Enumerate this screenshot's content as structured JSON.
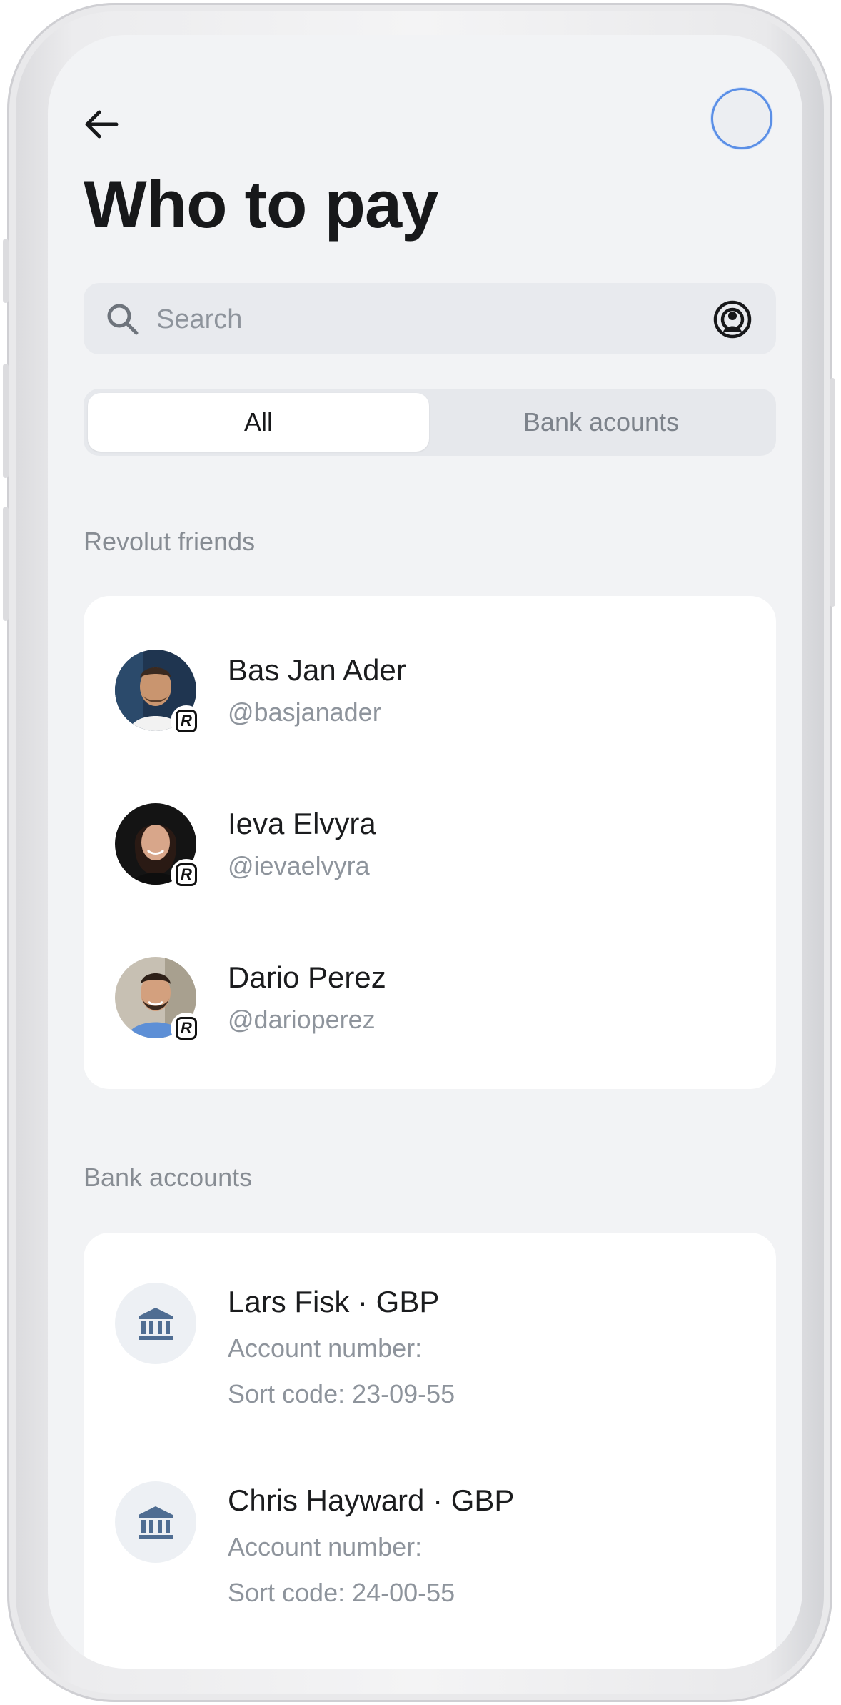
{
  "header": {
    "title": "Who to pay"
  },
  "search": {
    "placeholder": "Search"
  },
  "tabs": [
    {
      "label": "All",
      "active": true
    },
    {
      "label": "Bank acounts",
      "active": false
    }
  ],
  "friends_section": {
    "label": "Revolut friends",
    "items": [
      {
        "name": "Bas Jan Ader",
        "handle": "@basjanader",
        "badge": "R"
      },
      {
        "name": "Ieva Elvyra",
        "handle": "@ievaelvyra",
        "badge": "R"
      },
      {
        "name": "Dario Perez",
        "handle": "@darioperez",
        "badge": "R"
      }
    ]
  },
  "bank_section": {
    "label": "Bank accounts",
    "items": [
      {
        "title": "Lars Fisk · GBP",
        "account_label": "Account number:",
        "sort_code": "Sort code: 23-09-55"
      },
      {
        "title": "Chris Hayward · GBP",
        "account_label": "Account number:",
        "sort_code": "Sort code: 24-00-55"
      }
    ]
  },
  "colors": {
    "screen_bg": "#f2f3f5",
    "card_bg": "#ffffff",
    "accent_ring": "#5b8fe6",
    "bank_icon": "#4f6d92"
  }
}
